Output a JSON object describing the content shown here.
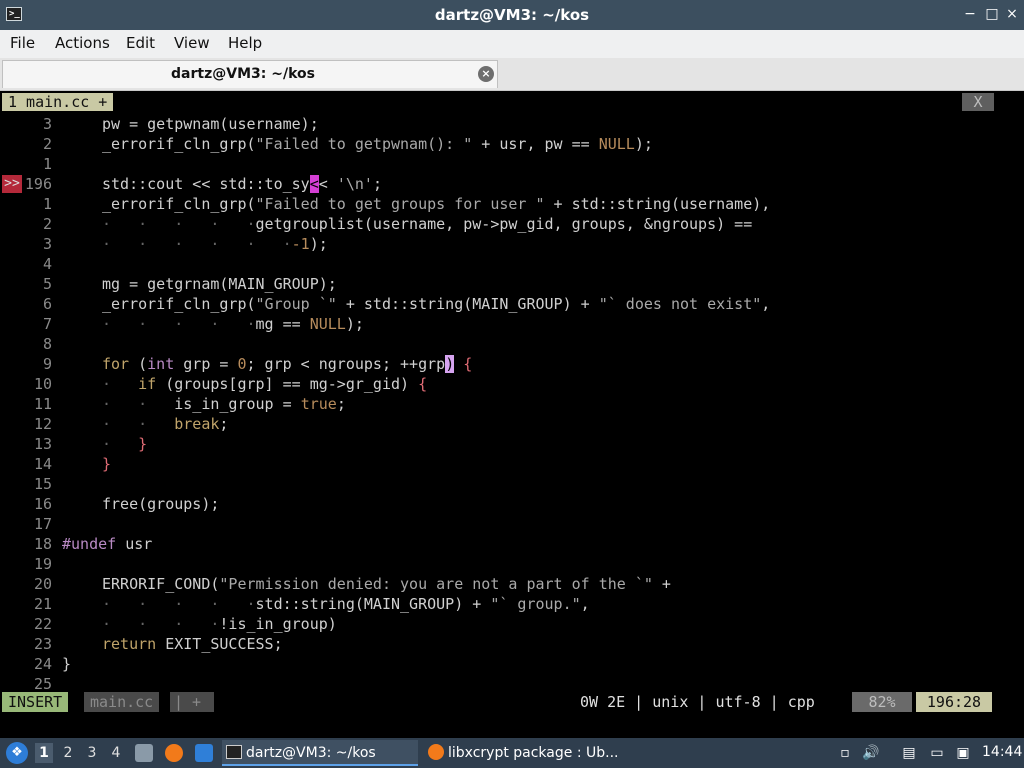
{
  "window": {
    "title": "dartz@VM3: ~/kos",
    "app_icon": "terminal-icon",
    "controls": [
      "−",
      "□",
      "×"
    ]
  },
  "menu": [
    "File",
    "Actions",
    "Edit",
    "View",
    "Help"
  ],
  "tab": {
    "title": "dartz@VM3: ~/kos",
    "close": "×"
  },
  "vim": {
    "tabline": {
      "tab": "1 main.cc +",
      "close": "X"
    },
    "marker": ">>",
    "lines": [
      {
        "n": "3",
        "html": "pw = getpwnam(username);"
      },
      {
        "n": "2",
        "html": "_errorif_cln_grp(<span class='st'>\"Failed to getpwnam(): \"</span> + usr, pw == <span class='nu'>NULL</span>);"
      },
      {
        "n": "1",
        "html": ""
      },
      {
        "n": "196",
        "html": "std::cout &lt;&lt; std::to_sy<span class='cursor'>&lt;</span>&lt; <span class='st'>'\\n'</span>;"
      },
      {
        "n": "1",
        "html": "_errorif_cln_grp(<span class='st'>\"Failed to get groups for user \"</span> + std::string(username),"
      },
      {
        "n": "2",
        "html": "<span class='dot'>·   ·   ·   ·   ·</span>getgrouplist(username, pw-&gt;pw_gid, groups, &amp;ngroups) =="
      },
      {
        "n": "3",
        "html": "<span class='dot'>·   ·   ·   ·   ·   ·</span><span class='nu'>-1</span>);"
      },
      {
        "n": "4",
        "html": ""
      },
      {
        "n": "5",
        "html": "mg = getgrnam(MAIN_GROUP);"
      },
      {
        "n": "6",
        "html": "_errorif_cln_grp(<span class='st'>\"Group `\"</span> + std::string(MAIN_GROUP) + <span class='st'>\"` does not exist\"</span>,"
      },
      {
        "n": "7",
        "html": "<span class='dot'>·   ·   ·   ·   ·</span>mg == <span class='nu'>NULL</span>);"
      },
      {
        "n": "8",
        "html": ""
      },
      {
        "n": "9",
        "html": "<span class='kw'>for</span> (<span class='ty'>int</span> grp = <span class='nu'>0</span>; grp &lt; ngroups; ++grp<span class='mb'>)</span> <span class='br'>{</span>"
      },
      {
        "n": "10",
        "html": "<span class='dot'>·</span>   <span class='kw'>if</span> (groups[grp] == mg-&gt;gr_gid) <span class='br'>{</span>"
      },
      {
        "n": "11",
        "html": "<span class='dot'>·   ·</span>   is_in_group = <span class='nu'>true</span>;"
      },
      {
        "n": "12",
        "html": "<span class='dot'>·   ·</span>   <span class='kw'>break</span>;"
      },
      {
        "n": "13",
        "html": "<span class='dot'>·</span>   <span class='br'>}</span>"
      },
      {
        "n": "14",
        "html": "<span class='br'>}</span>"
      },
      {
        "n": "15",
        "html": ""
      },
      {
        "n": "16",
        "html": "free(groups);"
      },
      {
        "n": "17",
        "html": ""
      },
      {
        "n": "18",
        "html": "<span class='co'>#undef</span> usr",
        "outdent": true
      },
      {
        "n": "19",
        "html": ""
      },
      {
        "n": "20",
        "html": "ERRORIF_COND(<span class='st'>\"Permission denied: you are not a part of the `\"</span> +"
      },
      {
        "n": "21",
        "html": "<span class='dot'>·   ·   ·   ·   ·</span>std::string(MAIN_GROUP) + <span class='st'>\"` group.\"</span>,"
      },
      {
        "n": "22",
        "html": "<span class='dot'>·   ·   ·   ·</span>!is_in_group)"
      },
      {
        "n": "23",
        "html": "<span class='kw'>return</span> EXIT_SUCCESS;"
      },
      {
        "n": "24",
        "html": "}",
        "outdent": true
      },
      {
        "n": "25",
        "html": ""
      }
    ],
    "status": {
      "mode": "INSERT",
      "file": "main.cc",
      "modified": "| +",
      "info": "0W 2E | unix | utf-8 | cpp",
      "percent": "82%",
      "position": "196:28"
    }
  },
  "taskbar": {
    "workspaces": [
      "1",
      "2",
      "3",
      "4"
    ],
    "tasks": [
      {
        "label": "dartz@VM3: ~/kos",
        "icon": "terminal-icon"
      },
      {
        "label": "libxcrypt package : Ub...",
        "icon": "firefox-icon"
      }
    ],
    "clock": "14:44",
    "colors": {
      "accent": "#5da1e8",
      "panel": "#2f3e4e"
    }
  }
}
